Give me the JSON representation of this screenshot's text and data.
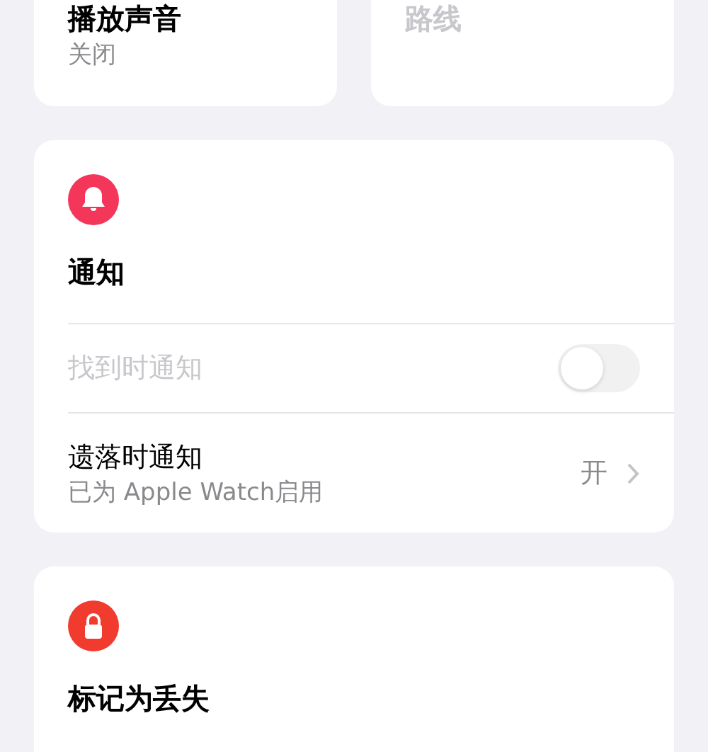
{
  "top_cards": [
    {
      "title": "播放声音",
      "subtitle": "关闭",
      "disabled": false
    },
    {
      "title": "路线",
      "disabled": true
    }
  ],
  "notifications": {
    "title": "通知",
    "rows": [
      {
        "kind": "toggle",
        "label": "找到时通知",
        "disabled": true,
        "on": false
      },
      {
        "kind": "link",
        "label": "遗落时通知",
        "subtitle": "已为 Apple Watch启用",
        "value": "开",
        "disabled": false
      }
    ]
  },
  "lost_mode": {
    "title": "标记为丢失"
  }
}
